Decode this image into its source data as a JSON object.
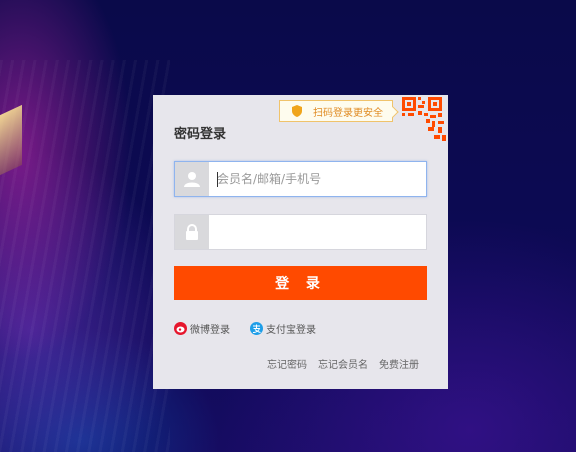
{
  "tip": {
    "label": "扫码登录更安全"
  },
  "panel": {
    "title": "密码登录"
  },
  "form": {
    "username_placeholder": "会员名/邮箱/手机号",
    "password_placeholder": "",
    "login_label": "登 录"
  },
  "alt_login": {
    "weibo_label": "微博登录",
    "alipay_label": "支付宝登录"
  },
  "links": {
    "forgot_password": "忘记密码",
    "forgot_username": "忘记会员名",
    "register": "免费注册"
  },
  "colors": {
    "accent": "#ff4a00",
    "tip_text": "#e08b23",
    "weibo": "#e6162d",
    "alipay": "#1e9ee8"
  }
}
